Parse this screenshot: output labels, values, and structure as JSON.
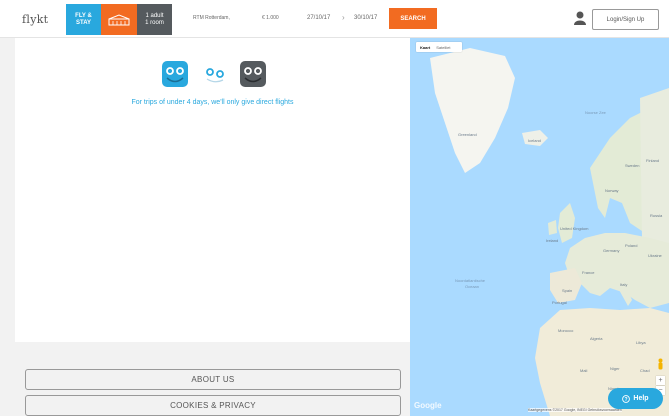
{
  "header": {
    "logo": "flykt",
    "tab_fly_line1": "FLY &",
    "tab_fly_line2": "STAY",
    "hotel_icon": "hotel-icon",
    "guests_line1": "1 adult",
    "guests_line2": "1 room",
    "from_value": "RTM Rotterdam,",
    "budget_value": "€ 1.000",
    "depart_date": "27/10/17",
    "return_date": "30/10/17",
    "date_separator": "›",
    "search_label": "SEARCH",
    "user_icon": "user-icon",
    "login_label": "Login/Sign Up"
  },
  "main": {
    "trip_icons": [
      "direct-flight-icon",
      "stopover-flight-icon",
      "multi-flight-icon"
    ],
    "note": "For trips of under 4 days, we'll only give direct flights"
  },
  "footer": {
    "about_label": "ABOUT US",
    "cookies_label": "COOKIES & PRIVACY"
  },
  "map": {
    "tab_map": "Kaart",
    "tab_satellite": "Satelliet",
    "labels": {
      "greenland": "Greenland",
      "iceland": "Iceland",
      "norway": "Norway",
      "finland": "Finland",
      "sweden": "Sweden",
      "russia": "Russia",
      "uk": "United Kingdom",
      "ireland": "Ireland",
      "germany": "Germany",
      "poland": "Poland",
      "ukraine": "Ukraine",
      "france": "France",
      "spain": "Spain",
      "italy": "Italy",
      "portugal": "Portugal",
      "morocco": "Morocco",
      "algeria": "Algeria",
      "libya": "Libya",
      "mali": "Mali",
      "niger": "Niger",
      "chad": "Chad",
      "nigeria": "Nigeria",
      "ocean1": "Noordatlantische",
      "ocean2": "Oceaan",
      "norwegian_sea": "Noorse Zee"
    },
    "google": "Google",
    "attribution": "Kaartgegevens ©2017 Google, INEGI   Gebruiksvoorwaarden",
    "zoom_in": "+",
    "zoom_out": "−",
    "pegman_icon": "pegman-icon"
  },
  "help": {
    "icon": "question-icon",
    "label": "Help"
  },
  "colors": {
    "brand_blue": "#29a8de",
    "brand_orange": "#f26b21",
    "dark_gray": "#555a5e",
    "water": "#aadaff",
    "land": "#e8ecde",
    "ice": "#f5f5f0"
  }
}
